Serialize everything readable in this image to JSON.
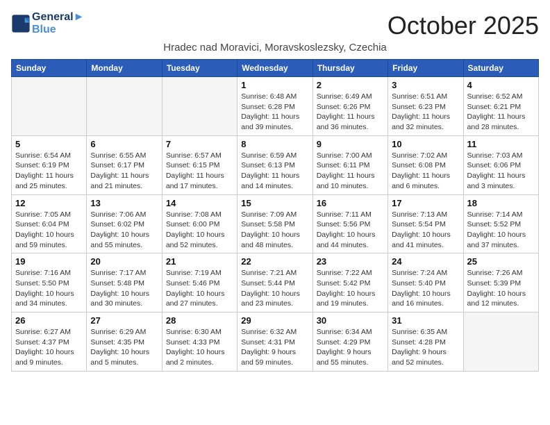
{
  "header": {
    "logo_line1": "General",
    "logo_line2": "Blue",
    "month_title": "October 2025",
    "subtitle": "Hradec nad Moravici, Moravskoslezsky, Czechia"
  },
  "weekdays": [
    "Sunday",
    "Monday",
    "Tuesday",
    "Wednesday",
    "Thursday",
    "Friday",
    "Saturday"
  ],
  "weeks": [
    [
      {
        "day": "",
        "info": ""
      },
      {
        "day": "",
        "info": ""
      },
      {
        "day": "",
        "info": ""
      },
      {
        "day": "1",
        "info": "Sunrise: 6:48 AM\nSunset: 6:28 PM\nDaylight: 11 hours\nand 39 minutes."
      },
      {
        "day": "2",
        "info": "Sunrise: 6:49 AM\nSunset: 6:26 PM\nDaylight: 11 hours\nand 36 minutes."
      },
      {
        "day": "3",
        "info": "Sunrise: 6:51 AM\nSunset: 6:23 PM\nDaylight: 11 hours\nand 32 minutes."
      },
      {
        "day": "4",
        "info": "Sunrise: 6:52 AM\nSunset: 6:21 PM\nDaylight: 11 hours\nand 28 minutes."
      }
    ],
    [
      {
        "day": "5",
        "info": "Sunrise: 6:54 AM\nSunset: 6:19 PM\nDaylight: 11 hours\nand 25 minutes."
      },
      {
        "day": "6",
        "info": "Sunrise: 6:55 AM\nSunset: 6:17 PM\nDaylight: 11 hours\nand 21 minutes."
      },
      {
        "day": "7",
        "info": "Sunrise: 6:57 AM\nSunset: 6:15 PM\nDaylight: 11 hours\nand 17 minutes."
      },
      {
        "day": "8",
        "info": "Sunrise: 6:59 AM\nSunset: 6:13 PM\nDaylight: 11 hours\nand 14 minutes."
      },
      {
        "day": "9",
        "info": "Sunrise: 7:00 AM\nSunset: 6:11 PM\nDaylight: 11 hours\nand 10 minutes."
      },
      {
        "day": "10",
        "info": "Sunrise: 7:02 AM\nSunset: 6:08 PM\nDaylight: 11 hours\nand 6 minutes."
      },
      {
        "day": "11",
        "info": "Sunrise: 7:03 AM\nSunset: 6:06 PM\nDaylight: 11 hours\nand 3 minutes."
      }
    ],
    [
      {
        "day": "12",
        "info": "Sunrise: 7:05 AM\nSunset: 6:04 PM\nDaylight: 10 hours\nand 59 minutes."
      },
      {
        "day": "13",
        "info": "Sunrise: 7:06 AM\nSunset: 6:02 PM\nDaylight: 10 hours\nand 55 minutes."
      },
      {
        "day": "14",
        "info": "Sunrise: 7:08 AM\nSunset: 6:00 PM\nDaylight: 10 hours\nand 52 minutes."
      },
      {
        "day": "15",
        "info": "Sunrise: 7:09 AM\nSunset: 5:58 PM\nDaylight: 10 hours\nand 48 minutes."
      },
      {
        "day": "16",
        "info": "Sunrise: 7:11 AM\nSunset: 5:56 PM\nDaylight: 10 hours\nand 44 minutes."
      },
      {
        "day": "17",
        "info": "Sunrise: 7:13 AM\nSunset: 5:54 PM\nDaylight: 10 hours\nand 41 minutes."
      },
      {
        "day": "18",
        "info": "Sunrise: 7:14 AM\nSunset: 5:52 PM\nDaylight: 10 hours\nand 37 minutes."
      }
    ],
    [
      {
        "day": "19",
        "info": "Sunrise: 7:16 AM\nSunset: 5:50 PM\nDaylight: 10 hours\nand 34 minutes."
      },
      {
        "day": "20",
        "info": "Sunrise: 7:17 AM\nSunset: 5:48 PM\nDaylight: 10 hours\nand 30 minutes."
      },
      {
        "day": "21",
        "info": "Sunrise: 7:19 AM\nSunset: 5:46 PM\nDaylight: 10 hours\nand 27 minutes."
      },
      {
        "day": "22",
        "info": "Sunrise: 7:21 AM\nSunset: 5:44 PM\nDaylight: 10 hours\nand 23 minutes."
      },
      {
        "day": "23",
        "info": "Sunrise: 7:22 AM\nSunset: 5:42 PM\nDaylight: 10 hours\nand 19 minutes."
      },
      {
        "day": "24",
        "info": "Sunrise: 7:24 AM\nSunset: 5:40 PM\nDaylight: 10 hours\nand 16 minutes."
      },
      {
        "day": "25",
        "info": "Sunrise: 7:26 AM\nSunset: 5:39 PM\nDaylight: 10 hours\nand 12 minutes."
      }
    ],
    [
      {
        "day": "26",
        "info": "Sunrise: 6:27 AM\nSunset: 4:37 PM\nDaylight: 10 hours\nand 9 minutes."
      },
      {
        "day": "27",
        "info": "Sunrise: 6:29 AM\nSunset: 4:35 PM\nDaylight: 10 hours\nand 5 minutes."
      },
      {
        "day": "28",
        "info": "Sunrise: 6:30 AM\nSunset: 4:33 PM\nDaylight: 10 hours\nand 2 minutes."
      },
      {
        "day": "29",
        "info": "Sunrise: 6:32 AM\nSunset: 4:31 PM\nDaylight: 9 hours\nand 59 minutes."
      },
      {
        "day": "30",
        "info": "Sunrise: 6:34 AM\nSunset: 4:29 PM\nDaylight: 9 hours\nand 55 minutes."
      },
      {
        "day": "31",
        "info": "Sunrise: 6:35 AM\nSunset: 4:28 PM\nDaylight: 9 hours\nand 52 minutes."
      },
      {
        "day": "",
        "info": ""
      }
    ]
  ]
}
